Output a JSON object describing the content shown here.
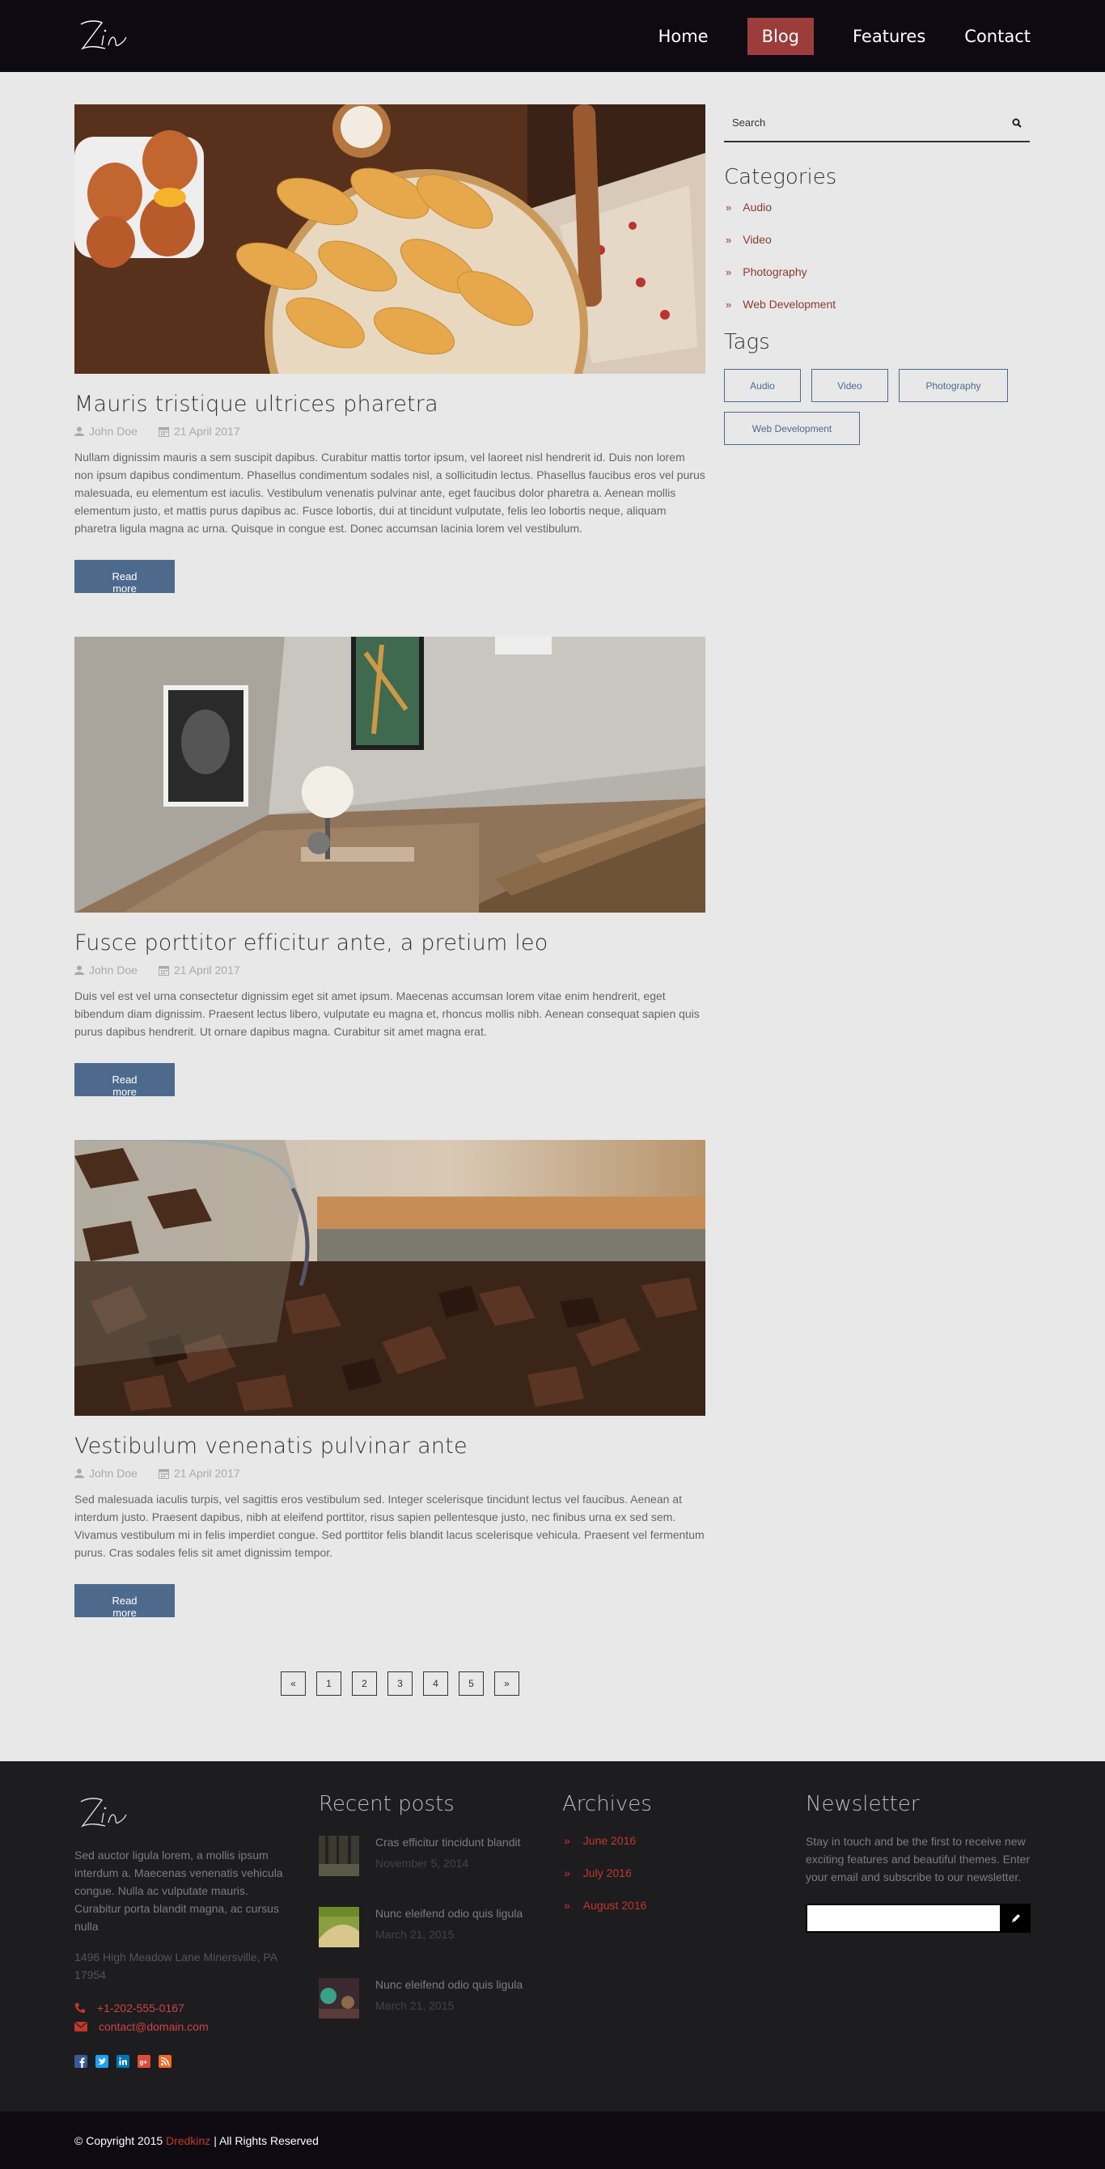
{
  "header": {
    "logo_text": "Zin",
    "nav": [
      {
        "label": "Home",
        "active": false
      },
      {
        "label": "Blog",
        "active": true
      },
      {
        "label": "Features",
        "active": false
      },
      {
        "label": "Contact",
        "active": false
      }
    ]
  },
  "posts": [
    {
      "title": "Mauris tristique ultrices pharetra",
      "author": "John Doe",
      "date": "21 April 2017",
      "excerpt": "Nullam dignissim mauris a sem suscipit dapibus. Curabitur mattis tortor ipsum, vel laoreet nisl hendrerit id. Duis non lorem non ipsum dapibus condimentum. Phasellus condimentum sodales nisl, a sollicitudin lectus. Phasellus faucibus eros vel purus malesuada, eu elementum est iaculis. Vestibulum venenatis pulvinar ante, eget faucibus dolor pharetra a. Aenean mollis elementum justo, et mattis purus dapibus ac. Fusce lobortis, dui at tincidunt vulputate, felis leo lobortis neque, aliquam pharetra ligula magna ac urna. Quisque in congue est. Donec accumsan lacinia lorem vel vestibulum.",
      "button": "Read more"
    },
    {
      "title": "Fusce porttitor efficitur ante, a pretium leo",
      "author": "John Doe",
      "date": "21 April 2017",
      "excerpt": "Duis vel est vel urna consectetur dignissim eget sit amet ipsum. Maecenas accumsan lorem vitae enim hendrerit, eget bibendum diam dignissim. Praesent lectus libero, vulputate eu magna et, rhoncus mollis nibh. Aenean consequat sapien quis purus dapibus hendrerit. Ut ornare dapibus magna. Curabitur sit amet magna erat.",
      "button": "Read more"
    },
    {
      "title": "Vestibulum venenatis pulvinar ante",
      "author": "John Doe",
      "date": "21 April 2017",
      "excerpt": "Sed malesuada iaculis turpis, vel sagittis eros vestibulum sed. Integer scelerisque tincidunt lectus vel faucibus. Aenean at interdum justo. Praesent dapibus, nibh at eleifend porttitor, risus sapien pellentesque justo, nec finibus urna ex sed sem. Vivamus vestibulum mi in felis imperdiet congue. Sed porttitor felis blandit lacus scelerisque vehicula. Praesent vel fermentum purus. Cras sodales felis sit amet dignissim tempor.",
      "button": "Read more"
    }
  ],
  "pagination": [
    "«",
    "1",
    "2",
    "3",
    "4",
    "5",
    "»"
  ],
  "sidebar": {
    "search_placeholder": "Search",
    "categories_title": "Categories",
    "categories": [
      "Audio",
      "Video",
      "Photography",
      "Web Development"
    ],
    "tags_title": "Tags",
    "tags": [
      "Audio",
      "Video",
      "Photography",
      "Web Development"
    ]
  },
  "footer": {
    "about": "Sed auctor ligula lorem, a mollis ipsum interdum a. Maecenas venenatis vehicula congue. Nulla ac vulputate mauris. Curabitur porta blandit magna, ac cursus nulla",
    "address": "1496 High Meadow Lane Minersville, PA 17954",
    "phone": "+1-202-555-0167",
    "email": "contact@domain.com",
    "recent_title": "Recent posts",
    "recent": [
      {
        "title": "Cras efficitur tincidunt blandit",
        "date": "November 5, 2014"
      },
      {
        "title": "Nunc eleifend odio quis ligula",
        "date": "March 21, 2015"
      },
      {
        "title": "Nunc eleifend odio quis ligula",
        "date": "March 21, 2015"
      }
    ],
    "archives_title": "Archives",
    "archives": [
      "June 2016",
      "July 2016",
      "August 2016"
    ],
    "newsletter_title": "Newsletter",
    "newsletter_text": "Stay in touch and be the first to receive new exciting features and beautiful themes. Enter your email and subscribe to our newsletter."
  },
  "bottom": {
    "copyright": "© Copyright 2015",
    "brand": "Dredkinz",
    "rights": "| All Rights Reserved"
  },
  "colors": {
    "header_bg": "#0e0a12",
    "accent_red": "#9c3d3b",
    "button_blue": "#4d6a8d",
    "footer_bg": "#1d1c1f"
  }
}
